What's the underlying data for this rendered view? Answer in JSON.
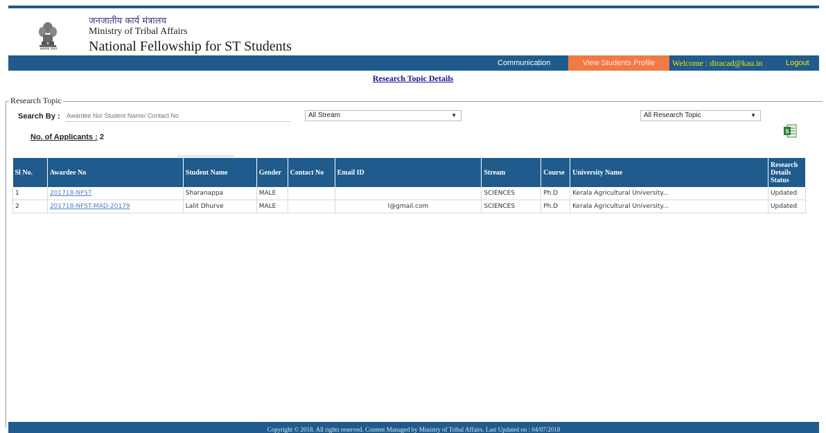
{
  "header": {
    "hindi_name": "जनजातीय कार्य मंत्रालय",
    "ministry": "Ministry of Tribal Affairs",
    "title": "National Fellowship for ST Students"
  },
  "nav": {
    "communication": "Communication",
    "view_profile": "View Students Profile",
    "welcome": "Welcome : diracad@kau.in",
    "logout": "Logout"
  },
  "page_heading": "Research Topic Details",
  "panel": {
    "legend": "Research Topic",
    "search_label": "Search By :",
    "search_placeholder": "Awardee No/ Student Name/ Contact No",
    "stream_select": "All Stream",
    "topic_select": "All Research Topic",
    "applicants_label": "No. of Applicants :",
    "applicants_count": "2"
  },
  "table": {
    "headers": [
      "Sl No.",
      "Awardee No",
      "Student Name",
      "Gender",
      "Contact No",
      "Email ID",
      "Stream",
      "Course",
      "University Name",
      "Research Details Status"
    ],
    "rows": [
      {
        "sl": "1",
        "awardee": "201718-NFST",
        "name": "Sharanappa",
        "gender": "MALE",
        "contact": "",
        "email": "",
        "stream": "SCIENCES",
        "course": "Ph.D",
        "university": "Kerala Agricultural University...",
        "status": "Updated"
      },
      {
        "sl": "2",
        "awardee": "201718-NFST-MAD-20179",
        "name": "Lalit Dhurve",
        "gender": "MALE",
        "contact": "",
        "email": "l@gmail.com",
        "stream": "SCIENCES",
        "course": "Ph.D",
        "university": "Kerala Agricultural University...",
        "status": "Updated"
      }
    ]
  },
  "footer": "Copyright © 2018. All rights reserved. Content Managed by Ministry of Tribal Affairs. Last Updated on : 04/07/2018",
  "colors": {
    "primary": "#1f5b8c",
    "accent": "#f07a43",
    "welcome": "#f2e600"
  }
}
